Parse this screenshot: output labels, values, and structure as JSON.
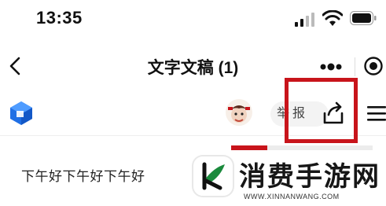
{
  "status_bar": {
    "time": "13:35",
    "signal_icon": "cellular-signal-icon",
    "wifi_icon": "wifi-icon",
    "battery_icon": "battery-icon"
  },
  "nav": {
    "back_icon": "chevron-left-icon",
    "title": "文字文稿 (1)",
    "more_icon": "more-dots-icon",
    "record_icon": "target-circle-icon"
  },
  "toolbar": {
    "logo_icon": "document-app-logo-icon",
    "avatar_icon": "avatar",
    "report_label": "举报",
    "share_icon": "share-icon",
    "menu_icon": "hamburger-menu-icon",
    "highlight_color": "#c8141b"
  },
  "document": {
    "body_text": "下午好下午好下午好"
  },
  "watermark": {
    "name": "消费手游网",
    "url": "WWW.XINNANWANG.COM",
    "accent_color": "#1a8a3c"
  }
}
